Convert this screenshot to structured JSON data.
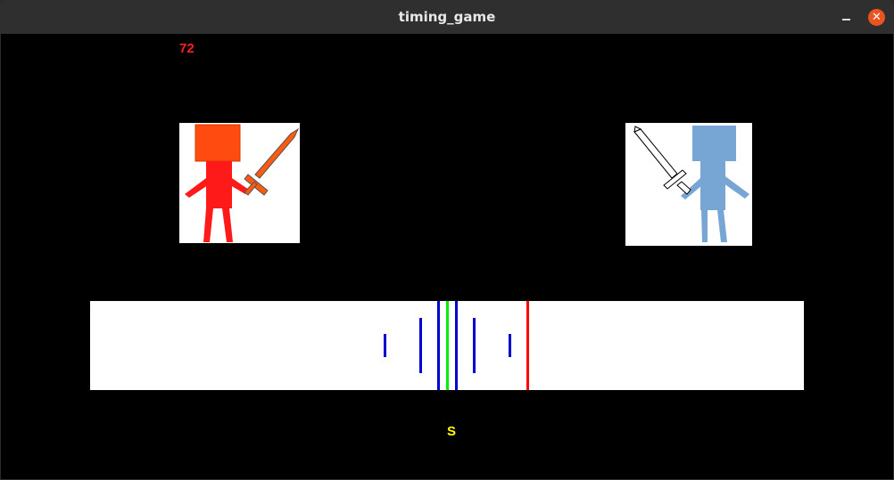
{
  "window": {
    "title": "timing_game",
    "close_glyph": "✕"
  },
  "hud": {
    "timer": "72",
    "key_hint": "S"
  },
  "characters": {
    "player": {
      "color": "#ff1a1a",
      "head_color": "#ff4a10",
      "sword": "orange-sword"
    },
    "enemy": {
      "color": "#78a6d4",
      "sword": "white-sword"
    }
  },
  "timing_bar": {
    "marks": [
      {
        "color": "#0000cc"
      },
      {
        "color": "#0000cc"
      },
      {
        "color": "#0000cc"
      },
      {
        "color": "#00ee00"
      },
      {
        "color": "#0000cc"
      },
      {
        "color": "#0000cc"
      },
      {
        "color": "#0000cc"
      },
      {
        "color": "#ff0000"
      }
    ]
  }
}
